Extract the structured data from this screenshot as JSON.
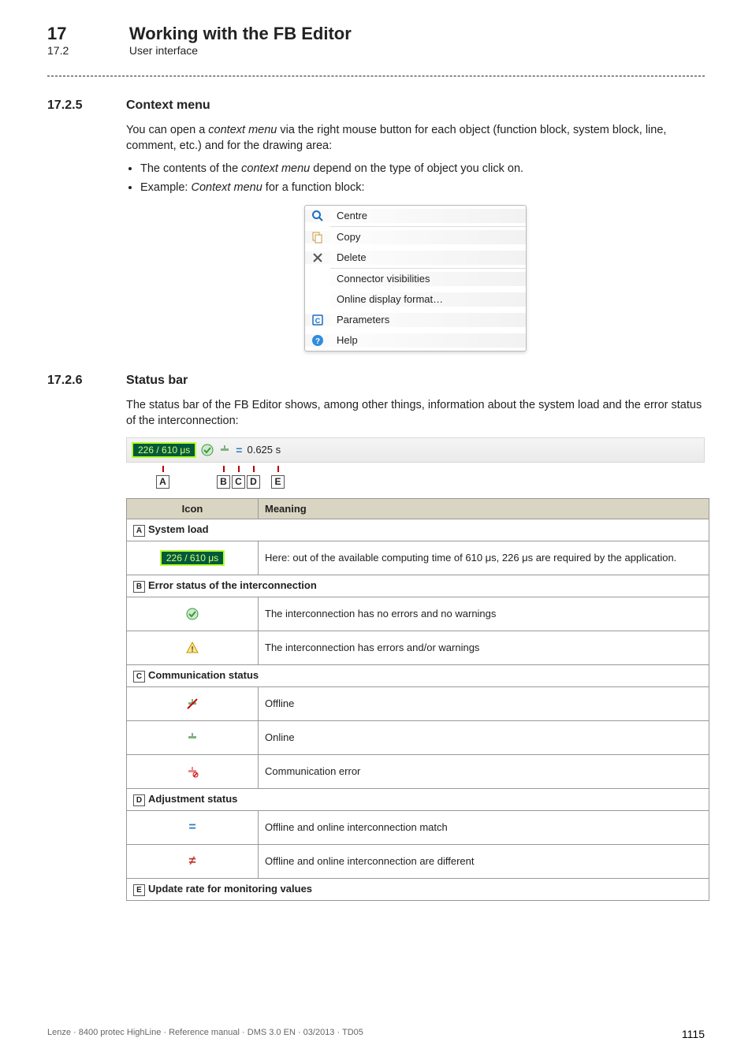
{
  "header": {
    "chapter_num": "17",
    "chapter_title": "Working with the FB Editor",
    "section_num": "17.2",
    "section_title": "User interface"
  },
  "sec_1725": {
    "num": "17.2.5",
    "title": "Context menu",
    "para": "You can open a context menu via the right mouse button for each object (function block, system block, line, comment, etc.) and for the drawing area:",
    "bullet1": "The contents of the context menu depend on the type of object you click on.",
    "bullet2": "Example: Context menu for a function block:",
    "menu": {
      "centre": "Centre",
      "copy": "Copy",
      "delete": "Delete",
      "connector": "Connector visibilities",
      "online": "Online display format…",
      "parameters": "Parameters",
      "help": "Help"
    }
  },
  "sec_1726": {
    "num": "17.2.6",
    "title": "Status bar",
    "para": "The status bar of the FB Editor shows, among other things, information about the system load and the error status of the interconnection:",
    "status": {
      "load": "226 / 610 μs",
      "time": "0.625 s"
    },
    "labels": {
      "A": "A",
      "B": "B",
      "C": "C",
      "D": "D",
      "E": "E"
    }
  },
  "table": {
    "col_icon": "Icon",
    "col_meaning": "Meaning",
    "A": {
      "head": "System load",
      "row1": {
        "load_value": "226 / 610 μs",
        "text": "Here: out of the available computing time of 610 μs, 226 μs are required by the application."
      }
    },
    "B": {
      "head": "Error status of the interconnection",
      "row1": "The interconnection has no errors and no warnings",
      "row2": "The interconnection has errors and/or warnings"
    },
    "C": {
      "head": "Communication status",
      "row1": "Offline",
      "row2": "Online",
      "row3": "Communication error"
    },
    "D": {
      "head": "Adjustment status",
      "row1": "Offline and online interconnection match",
      "row2": "Offline and online interconnection are different"
    },
    "E": {
      "head": "Update rate for monitoring values"
    }
  },
  "footer": {
    "left": "Lenze · 8400 protec HighLine · Reference manual · DMS 3.0 EN · 03/2013 · TD05",
    "right": "1115"
  }
}
